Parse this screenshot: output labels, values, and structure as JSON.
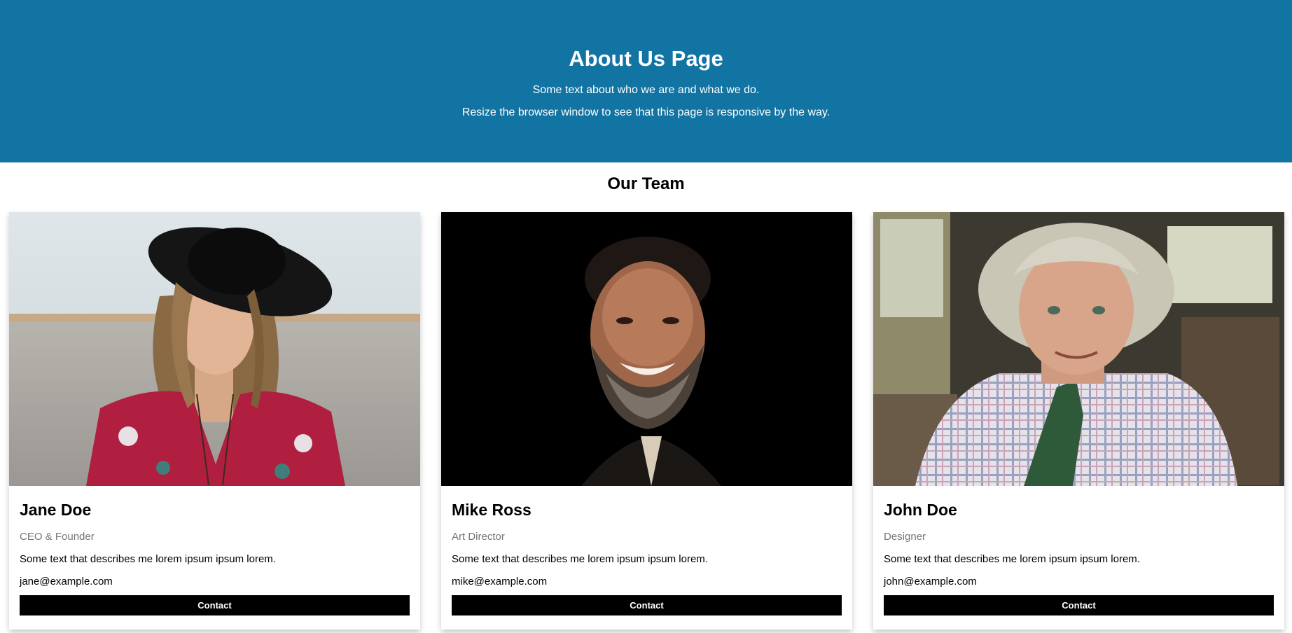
{
  "hero": {
    "title": "About Us Page",
    "line1": "Some text about who we are and what we do.",
    "line2": "Resize the browser window to see that this page is responsive by the way.",
    "bg_color": "#1274a3"
  },
  "team_heading": "Our Team",
  "members": [
    {
      "name": "Jane Doe",
      "title": "CEO & Founder",
      "description": "Some text that describes me lorem ipsum ipsum lorem.",
      "email": "jane@example.com",
      "button_label": "Contact"
    },
    {
      "name": "Mike Ross",
      "title": "Art Director",
      "description": "Some text that describes me lorem ipsum ipsum lorem.",
      "email": "mike@example.com",
      "button_label": "Contact"
    },
    {
      "name": "John Doe",
      "title": "Designer",
      "description": "Some text that describes me lorem ipsum ipsum lorem.",
      "email": "john@example.com",
      "button_label": "Contact"
    }
  ]
}
